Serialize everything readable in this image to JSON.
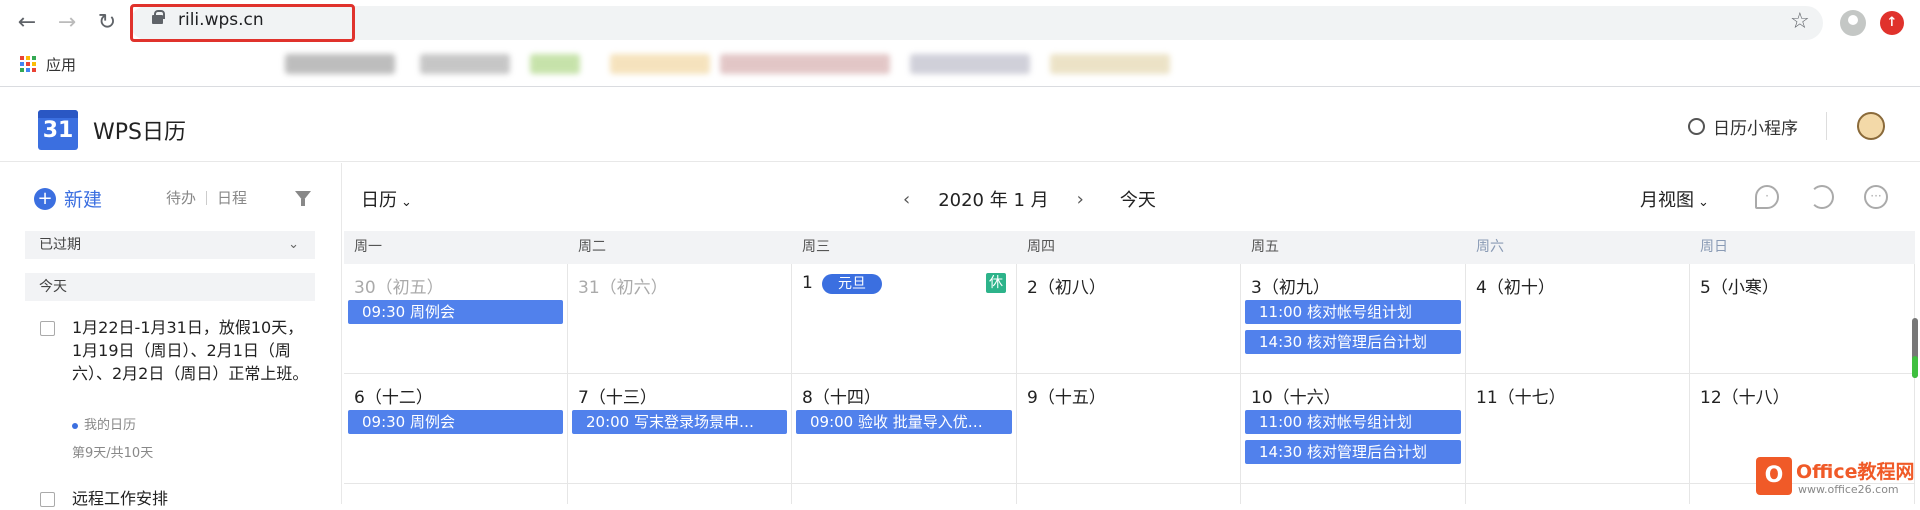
{
  "browser": {
    "url": "rili.wps.cn",
    "bookmarks_label": "应用"
  },
  "app": {
    "logo_text": "31",
    "title": "WPS日历",
    "mini_program": "日历小程序"
  },
  "sidebar": {
    "new_label": "新建",
    "tab_todo": "待办",
    "tab_schedule": "日程",
    "section_overdue": "已过期",
    "section_today": "今天",
    "todo1_text": "1月22日-1月31日，放假10天，1月19日（周日）、2月1日（周六）、2月2日（周日）正常上班。",
    "todo1_calendar": "我的日历",
    "todo1_progress": "第9天/共10天",
    "todo2_text": "远程工作安排"
  },
  "toolbar": {
    "calendar_dropdown": "日历",
    "month_label": "2020 年 1 月",
    "today_label": "今天",
    "view_label": "月视图"
  },
  "week_headers": [
    "周一",
    "周二",
    "周三",
    "周四",
    "周五",
    "周六",
    "周日"
  ],
  "week1": {
    "d1": "30（初五）",
    "d2": "31（初六）",
    "d3": "1",
    "d4": "2（初八）",
    "d5": "3（初九）",
    "d6": "4（初十）",
    "d7": "5（小寒）",
    "holiday": "元旦",
    "rest": "休",
    "e_mon": "09:30 周例会",
    "e_fri1": "11:00 核对帐号组计划",
    "e_fri2": "14:30 核对管理后台计划"
  },
  "week2": {
    "d1": "6（十二）",
    "d2": "7（十三）",
    "d3": "8（十四）",
    "d4": "9（十五）",
    "d5": "10（十六）",
    "d6": "11（十七）",
    "d7": "12（十八）",
    "e_mon": "09:30 周例会",
    "e_tue": "20:00 写末登录场景申…",
    "e_wed": "09:00 验收 批量导入优…",
    "e_fri1": "11:00 核对帐号组计划",
    "e_fri2": "14:30 核对管理后台计划"
  },
  "watermark": {
    "title": "Office教程网",
    "url": "www.office26.com",
    "logo": "O"
  },
  "colors": {
    "accent": "#3b6fe0",
    "event_bg": "#5181ec",
    "rest_badge": "#2db38a",
    "url_highlight": "#e0322c"
  }
}
